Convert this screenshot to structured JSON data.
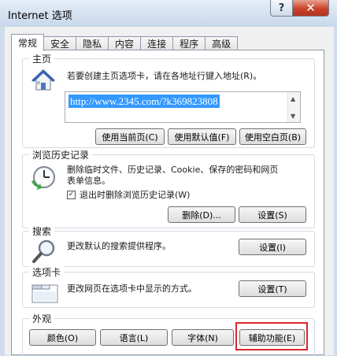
{
  "window": {
    "title": "Internet 选项",
    "help_glyph": "?",
    "close_glyph": "✕"
  },
  "tabs": [
    "常规",
    "安全",
    "隐私",
    "内容",
    "连接",
    "程序",
    "高级"
  ],
  "homepage": {
    "label": "主页",
    "description": "若要创建主页选项卡，请在各地址行键入地址(R)。",
    "url": "http://www.2345.com/?k369823808",
    "use_current": "使用当前页(C)",
    "use_default": "使用默认值(F)",
    "use_blank": "使用空白页(B)"
  },
  "history": {
    "label": "浏览历史记录",
    "description_line1": "删除临时文件、历史记录、Cookie、保存的密码和网页",
    "description_line2": "表单信息。",
    "checkbox_label": "退出时删除浏览历史记录(W)",
    "checkbox_checked": true,
    "delete_button": "删除(D)...",
    "settings_button": "设置(S)"
  },
  "search": {
    "label": "搜索",
    "description": "更改默认的搜索提供程序。",
    "settings_button": "设置(I)"
  },
  "tabs_group": {
    "label": "选项卡",
    "description": "更改网页在选项卡中显示的方式。",
    "settings_button": "设置(T)"
  },
  "appearance": {
    "label": "外观",
    "colors_button": "颜色(O)",
    "languages_button": "语言(L)",
    "fonts_button": "字体(N)",
    "accessibility_button": "辅助功能(E)"
  },
  "colors": {
    "highlight": "#d9292a",
    "selection": "#3399ff"
  }
}
